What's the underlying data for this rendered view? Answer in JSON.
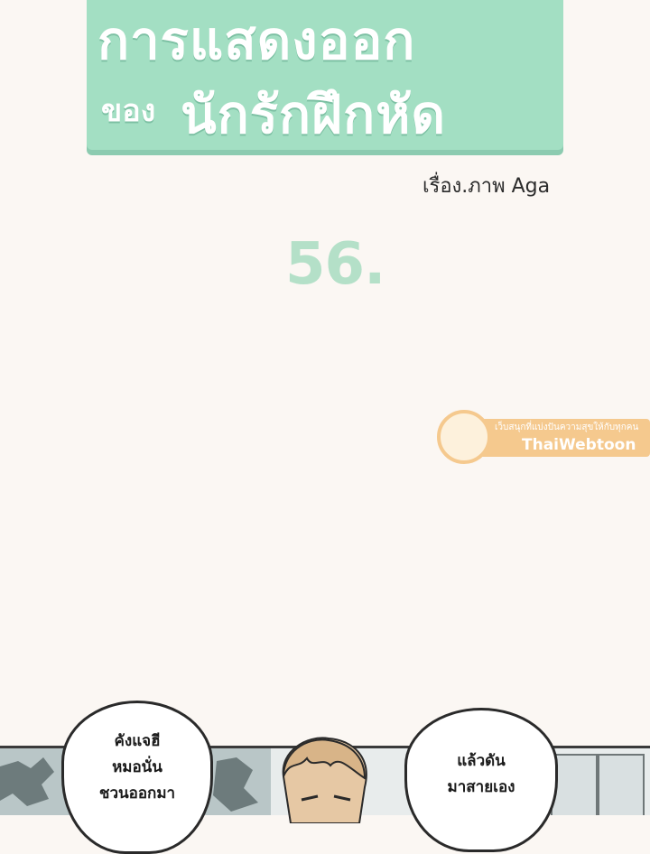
{
  "title": {
    "line1": "การแสดงออก",
    "line2_prefix": "ของ",
    "line2": "นักรักฝึกหัด"
  },
  "credit": "เรื่อง.ภาพ Aga",
  "episode": "56.",
  "watermark": {
    "logo_text": "Thai Webtoon",
    "tagline": "เว็บสนุกที่แบ่งปันความสุขให้กับทุกคน",
    "brand": "ThaiWebtoon"
  },
  "panel": {
    "bubble_left": [
      "คังแจฮี",
      "หมอนั่น",
      "ชวนออกมา"
    ],
    "bubble_right": [
      "แล้วดัน",
      "มาสายเอง"
    ]
  },
  "colors": {
    "background": "#fbf7f3",
    "title_banner": "#a3dfc3",
    "episode": "#b4e0c8",
    "watermark": "#f5c98e"
  }
}
